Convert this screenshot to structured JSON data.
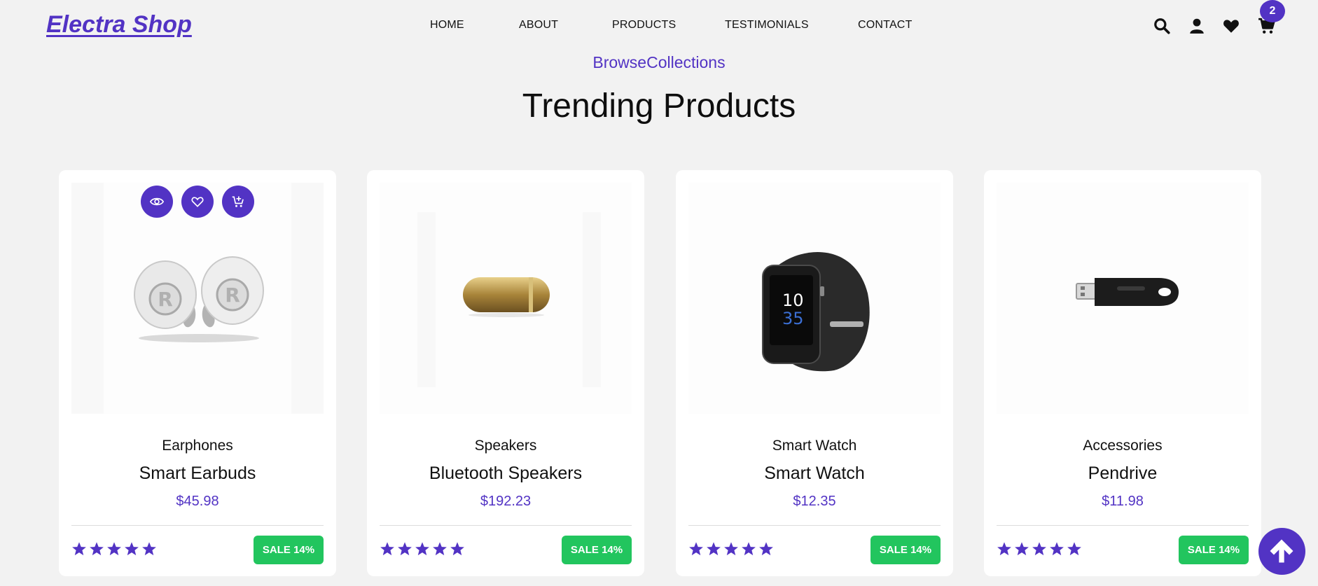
{
  "brand": {
    "logo": "Electra Shop",
    "accent_color": "#5233c4",
    "sale_color": "#22c55e"
  },
  "nav": {
    "items": [
      {
        "label": "HOME"
      },
      {
        "label": "ABOUT"
      },
      {
        "label": "PRODUCTS"
      },
      {
        "label": "TESTIMONIALS"
      },
      {
        "label": "CONTACT"
      }
    ]
  },
  "header_icons": [
    "search-icon",
    "user-icon",
    "heart-icon",
    "cart-icon"
  ],
  "cart": {
    "count": "2"
  },
  "section": {
    "subtitle": "BrowseCollections",
    "title": "Trending Products"
  },
  "products": [
    {
      "category": "Earphones",
      "name": "Smart Earbuds",
      "price": "$45.98",
      "rating": 5,
      "sale": "SALE 14%"
    },
    {
      "category": "Speakers",
      "name": "Bluetooth Speakers",
      "price": "$192.23",
      "rating": 5,
      "sale": "SALE 14%"
    },
    {
      "category": "Smart Watch",
      "name": "Smart Watch",
      "price": "$12.35",
      "rating": 5,
      "sale": "SALE 14%"
    },
    {
      "category": "Accessories",
      "name": "Pendrive",
      "price": "$11.98",
      "rating": 5,
      "sale": "SALE 14%"
    }
  ],
  "card_actions": [
    "eye-icon",
    "heart-outline-icon",
    "cart-plus-icon"
  ],
  "watch_display": {
    "hour": "10",
    "minute": "35"
  }
}
